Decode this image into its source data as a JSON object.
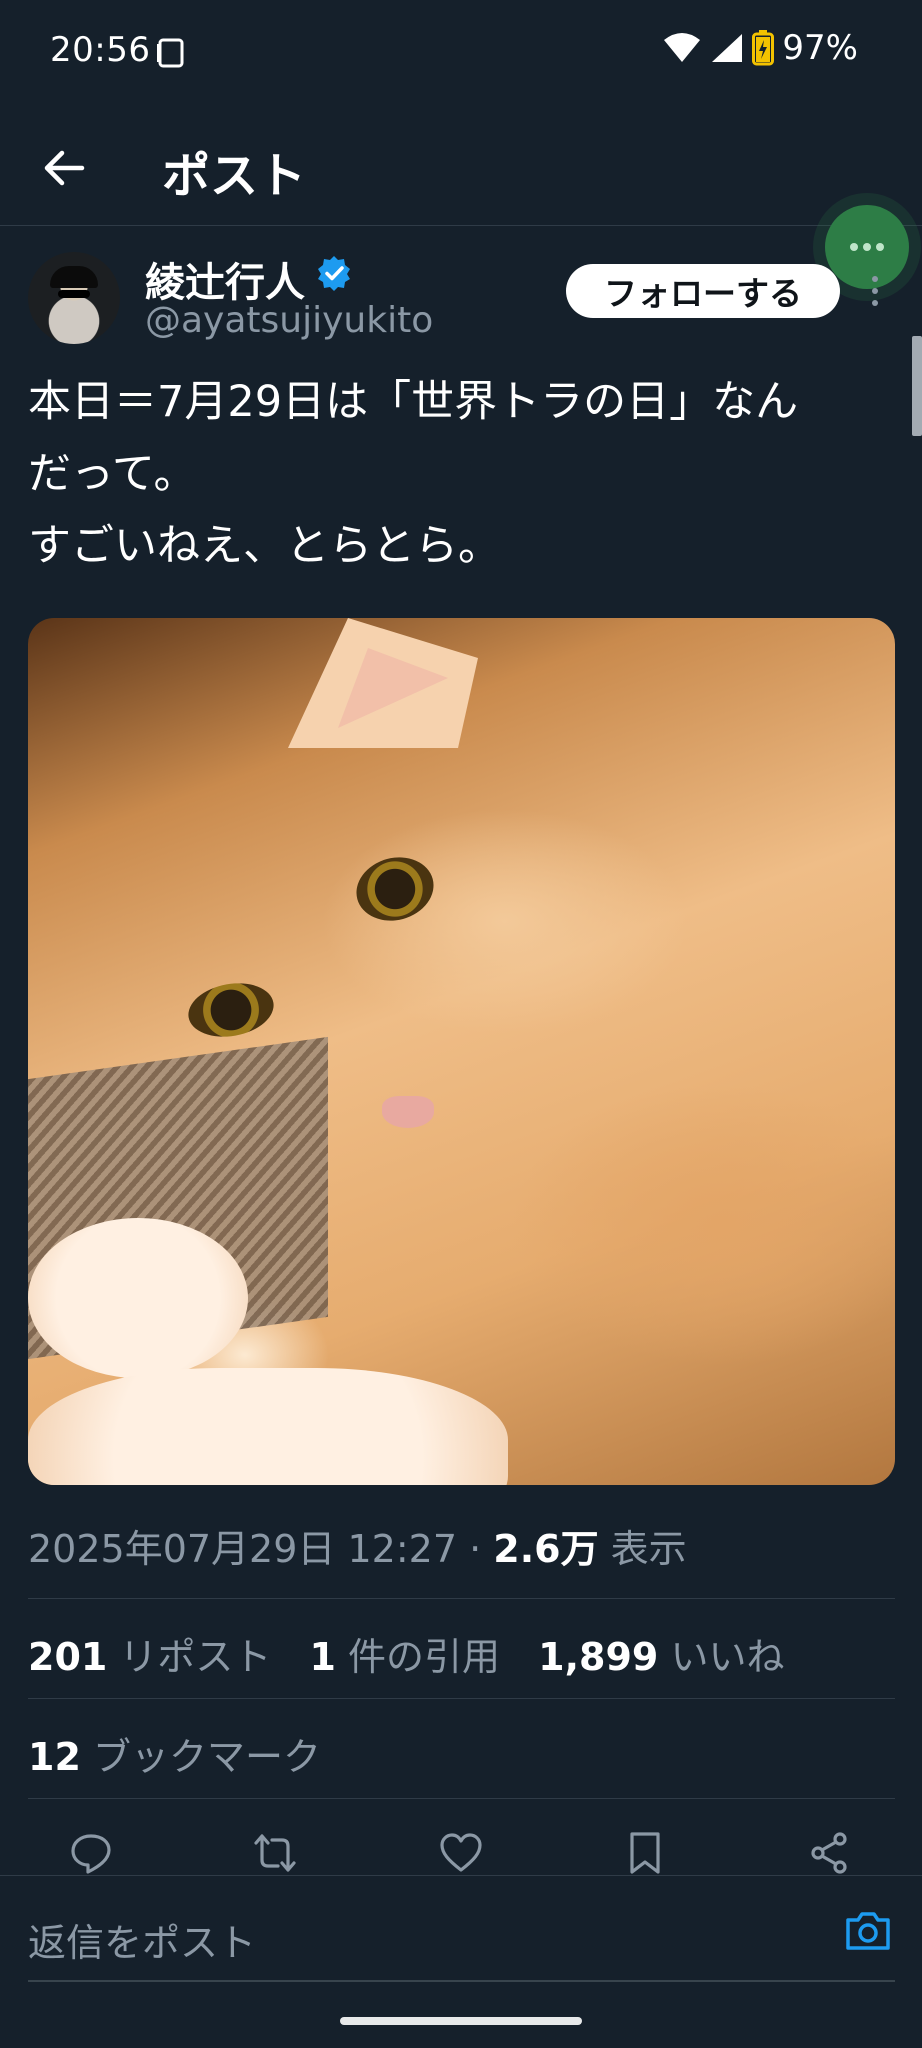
{
  "status_bar": {
    "time": "20:56",
    "battery": "97%"
  },
  "header": {
    "title": "ポスト"
  },
  "author": {
    "display_name": "綾辻行人",
    "handle": "@ayatsujiyukito",
    "follow_label": "フォローする"
  },
  "tweet": {
    "lines": [
      "本日＝7月29日は「世界トラの日」なん",
      "だって。",
      "すごいねえ、とらとら。"
    ]
  },
  "meta": {
    "date": "2025年07月29日 12:27 · ",
    "views_count": "2.6万",
    "views_label": " 表示"
  },
  "stats": {
    "reposts_count": "201",
    "reposts_label": " リポスト",
    "quotes_count": "1",
    "quotes_label": " 件の引用",
    "likes_count": "1,899",
    "likes_label": " いいね",
    "bookmarks_count": "12",
    "bookmarks_label": " ブックマーク"
  },
  "reply": {
    "placeholder": "返信をポスト"
  },
  "colors": {
    "background": "#15202b",
    "accent": "#1d9bf0",
    "muted": "#8b98a5"
  }
}
